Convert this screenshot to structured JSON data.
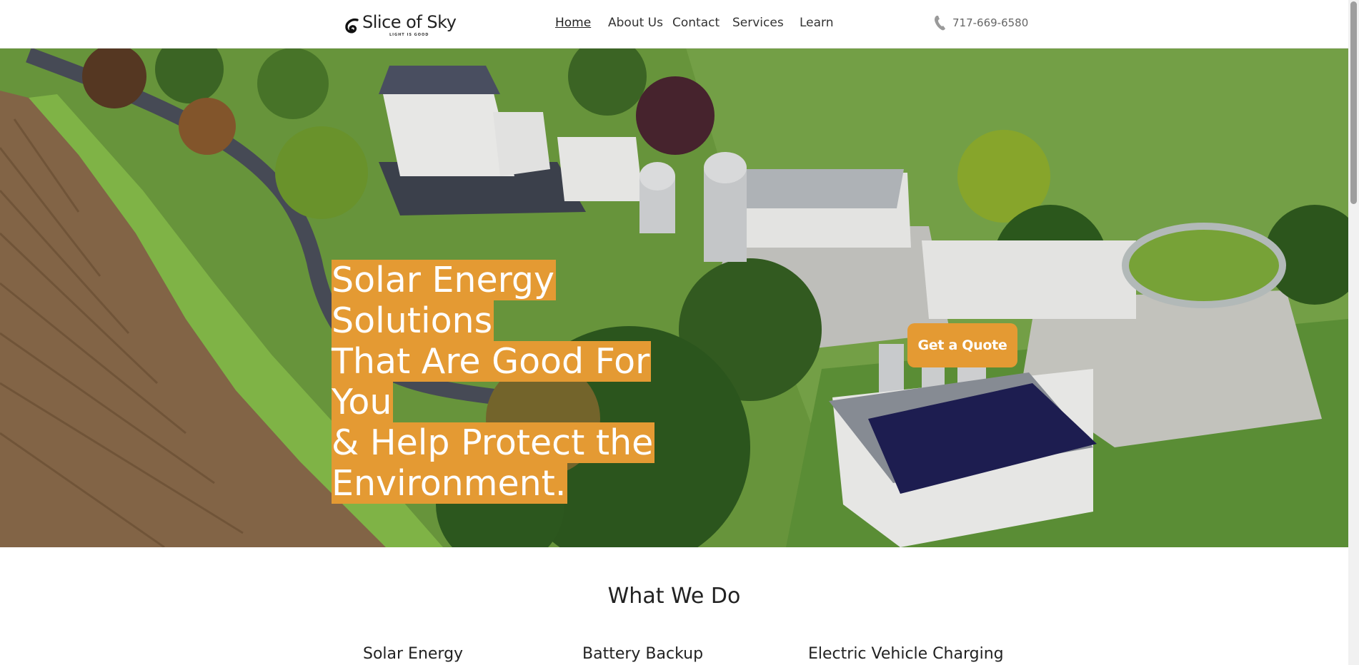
{
  "brand": {
    "name": "Slice of Sky",
    "tagline": "LIGHT IS GOOD"
  },
  "nav": {
    "items": [
      {
        "label": "Home",
        "active": true
      },
      {
        "label": "About Us",
        "active": false
      },
      {
        "label": "Contact",
        "active": false
      },
      {
        "label": "Services",
        "active": false
      },
      {
        "label": "Learn",
        "active": false
      }
    ]
  },
  "contact": {
    "phone": "717-669-6580",
    "icon": "phone-icon"
  },
  "hero": {
    "headline_lines": [
      "Solar Energy Solutions",
      "That Are Good For You",
      "& Help Protect the",
      "Environment."
    ],
    "cta_label": "Get a Quote",
    "image": "aerial-farm-photo"
  },
  "what_we_do": {
    "title": "What We Do",
    "services": [
      {
        "label": "Solar Energy"
      },
      {
        "label": "Battery Backup"
      },
      {
        "label": "Electric Vehicle Charging"
      }
    ]
  },
  "colors": {
    "accent": "#e49a33",
    "text": "#222222",
    "muted": "#666666"
  }
}
